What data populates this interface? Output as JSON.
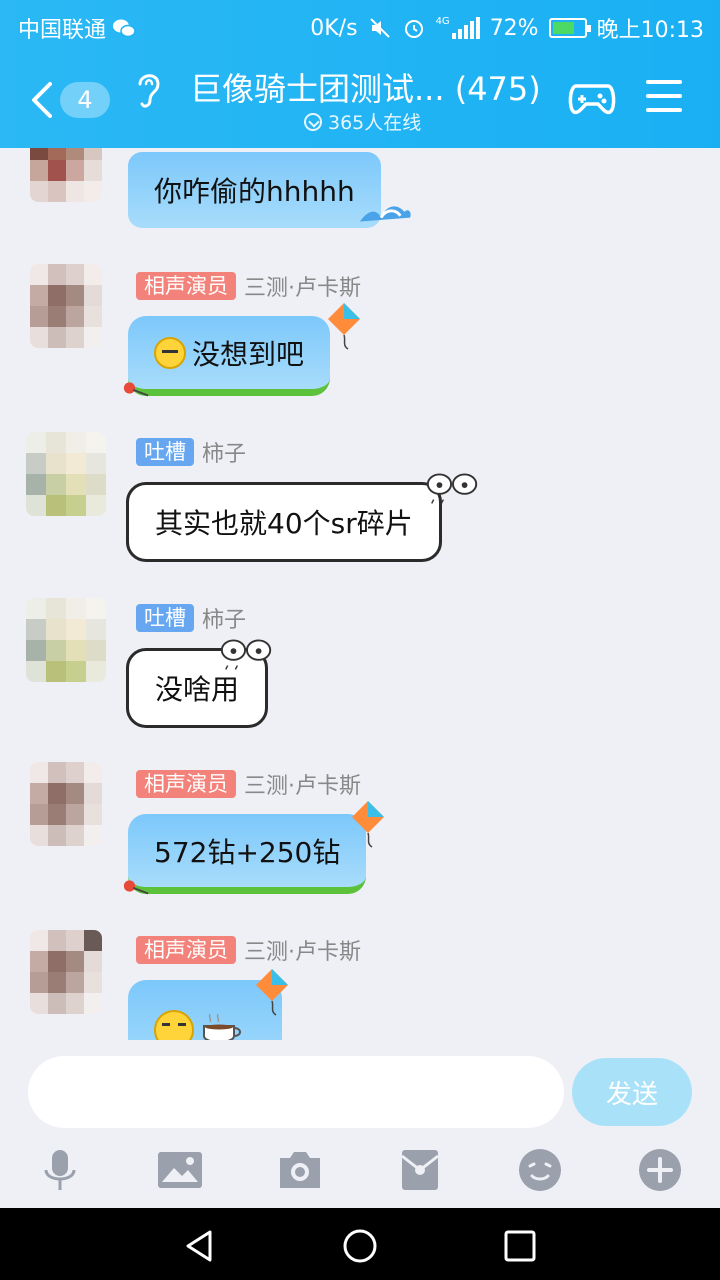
{
  "status_bar": {
    "carrier": "中国联通",
    "net_speed": "0K/s",
    "network_type": "4G",
    "battery": "72%",
    "battery_level": 0.72,
    "time": "晚上10:13"
  },
  "header": {
    "back_count": "4",
    "title": "巨像骑士团测试...",
    "member_count": "(475)",
    "online": "365人在线"
  },
  "messages": [
    {
      "tag": "",
      "sender": "",
      "text": "你咋偷的hhhhh"
    },
    {
      "tag": "相声演员",
      "sender": "三测·卢卡斯",
      "text": "没想到吧"
    },
    {
      "tag": "吐槽",
      "sender": "柿子",
      "text": "其实也就40个sr碎片"
    },
    {
      "tag": "吐槽",
      "sender": "柿子",
      "text": "没啥用"
    },
    {
      "tag": "相声演员",
      "sender": "三测·卢卡斯",
      "text": "572钻+250钻"
    },
    {
      "tag": "相声演员",
      "sender": "三测·卢卡斯",
      "text": ""
    }
  ],
  "input": {
    "placeholder": "",
    "send_label": "发送"
  },
  "toolbar": [
    "microphone-icon",
    "image-icon",
    "camera-icon",
    "red-packet-icon",
    "emoji-icon",
    "plus-icon"
  ],
  "colors": {
    "header": "#1fb2f4",
    "tag_red": "#f2827a",
    "tag_blue": "#67a7f1",
    "send_button": "#a9e2f8"
  }
}
